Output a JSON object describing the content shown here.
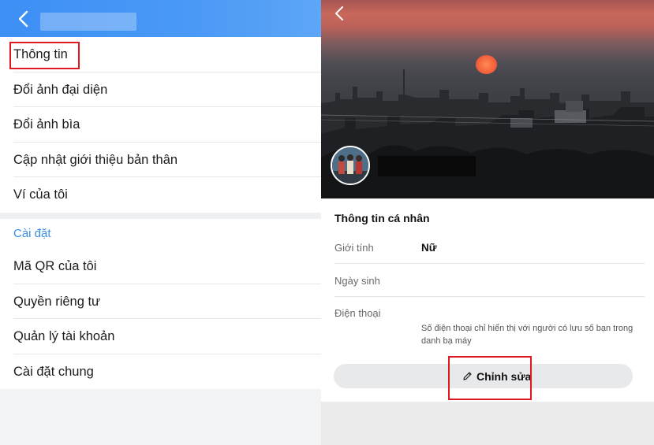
{
  "left_panel": {
    "menu_items": [
      {
        "label": "Thông tin"
      },
      {
        "label": "Đổi ảnh đại diện"
      },
      {
        "label": "Đổi ảnh bìa"
      },
      {
        "label": "Cập nhật giới thiệu bản thân"
      },
      {
        "label": "Ví của tôi"
      }
    ],
    "settings_title": "Cài đặt",
    "settings_items": [
      {
        "label": "Mã QR của tôi"
      },
      {
        "label": "Quyền riêng tư"
      },
      {
        "label": "Quản lý tài khoản"
      },
      {
        "label": "Cài đặt chung"
      }
    ]
  },
  "right_panel": {
    "info_title": "Thông tin cá nhân",
    "rows": {
      "gender_label": "Giới tính",
      "gender_value": "Nữ",
      "birthday_label": "Ngày sinh",
      "phone_label": "Điện thoại",
      "phone_note": "Số điện thoại chỉ hiển thị với người có lưu số bạn trong danh bạ máy"
    },
    "edit_label": "Chỉnh sửa"
  },
  "colors": {
    "header_blue": "#4a99f6",
    "accent_blue": "#3a8ee6",
    "highlight_red": "#e0181f"
  },
  "icons": {
    "back": "chevron-left-icon",
    "edit": "pencil-icon"
  }
}
